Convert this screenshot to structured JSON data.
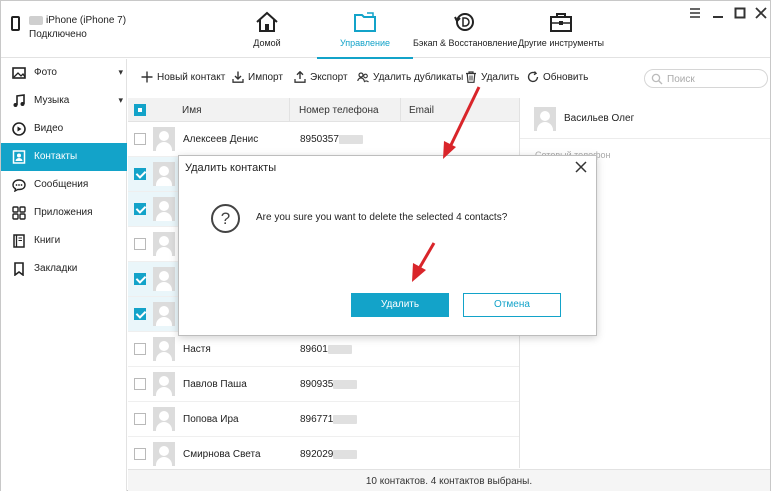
{
  "header": {
    "device_name": "iPhone (iPhone 7)",
    "device_status": "Подключено",
    "tabs": [
      {
        "label": "Домой",
        "icon": "home-icon",
        "active": false
      },
      {
        "label": "Управление",
        "icon": "folder-icon",
        "active": true
      },
      {
        "label": "Бэкап & Восстановление",
        "icon": "backup-icon",
        "active": false
      },
      {
        "label": "Другие инструменты",
        "icon": "toolbox-icon",
        "active": false
      }
    ]
  },
  "sidebar": {
    "items": [
      {
        "label": "Фото",
        "icon": "photo-icon",
        "expandable": true
      },
      {
        "label": "Музыка",
        "icon": "music-icon",
        "expandable": true
      },
      {
        "label": "Видео",
        "icon": "video-icon"
      },
      {
        "label": "Контакты",
        "icon": "contacts-icon",
        "active": true
      },
      {
        "label": "Сообщения",
        "icon": "messages-icon"
      },
      {
        "label": "Приложения",
        "icon": "apps-icon"
      },
      {
        "label": "Книги",
        "icon": "books-icon"
      },
      {
        "label": "Закладки",
        "icon": "bookmarks-icon"
      }
    ]
  },
  "toolbar": {
    "new_contact": "Новый контакт",
    "import": "Импорт",
    "export": "Экспорт",
    "dedupe": "Удалить дубликаты",
    "delete": "Удалить",
    "refresh": "Обновить",
    "search_placeholder": "Поиск"
  },
  "table": {
    "headers": {
      "name": "Имя",
      "phone": "Номер телефона",
      "email": "Email"
    },
    "rows": [
      {
        "name": "Алексеев Денис",
        "phone": "8950357",
        "selected": false
      },
      {
        "name": "",
        "phone": "",
        "selected": true
      },
      {
        "name": "",
        "phone": "",
        "selected": true
      },
      {
        "name": "",
        "phone": "",
        "selected": false
      },
      {
        "name": "",
        "phone": "",
        "selected": true
      },
      {
        "name": "",
        "phone": "",
        "selected": true
      },
      {
        "name": "Настя",
        "phone": "89601",
        "selected": false
      },
      {
        "name": "Павлов Паша",
        "phone": "890935",
        "selected": false
      },
      {
        "name": "Попова Ира",
        "phone": "896771",
        "selected": false
      },
      {
        "name": "Смирнова Света",
        "phone": "892029",
        "selected": false
      }
    ]
  },
  "status": {
    "text": "10 контактов. 4 контактов выбраны."
  },
  "details": {
    "contact_name": "Васильев Олег",
    "field_label": "Сотовый телефон"
  },
  "dialog": {
    "title": "Удалить контакты",
    "message": "Are you sure you want to delete the selected 4 contacts?",
    "confirm": "Удалить",
    "cancel": "Отмена"
  },
  "colors": {
    "accent": "#13a3c9",
    "annotation": "#d9252a"
  }
}
